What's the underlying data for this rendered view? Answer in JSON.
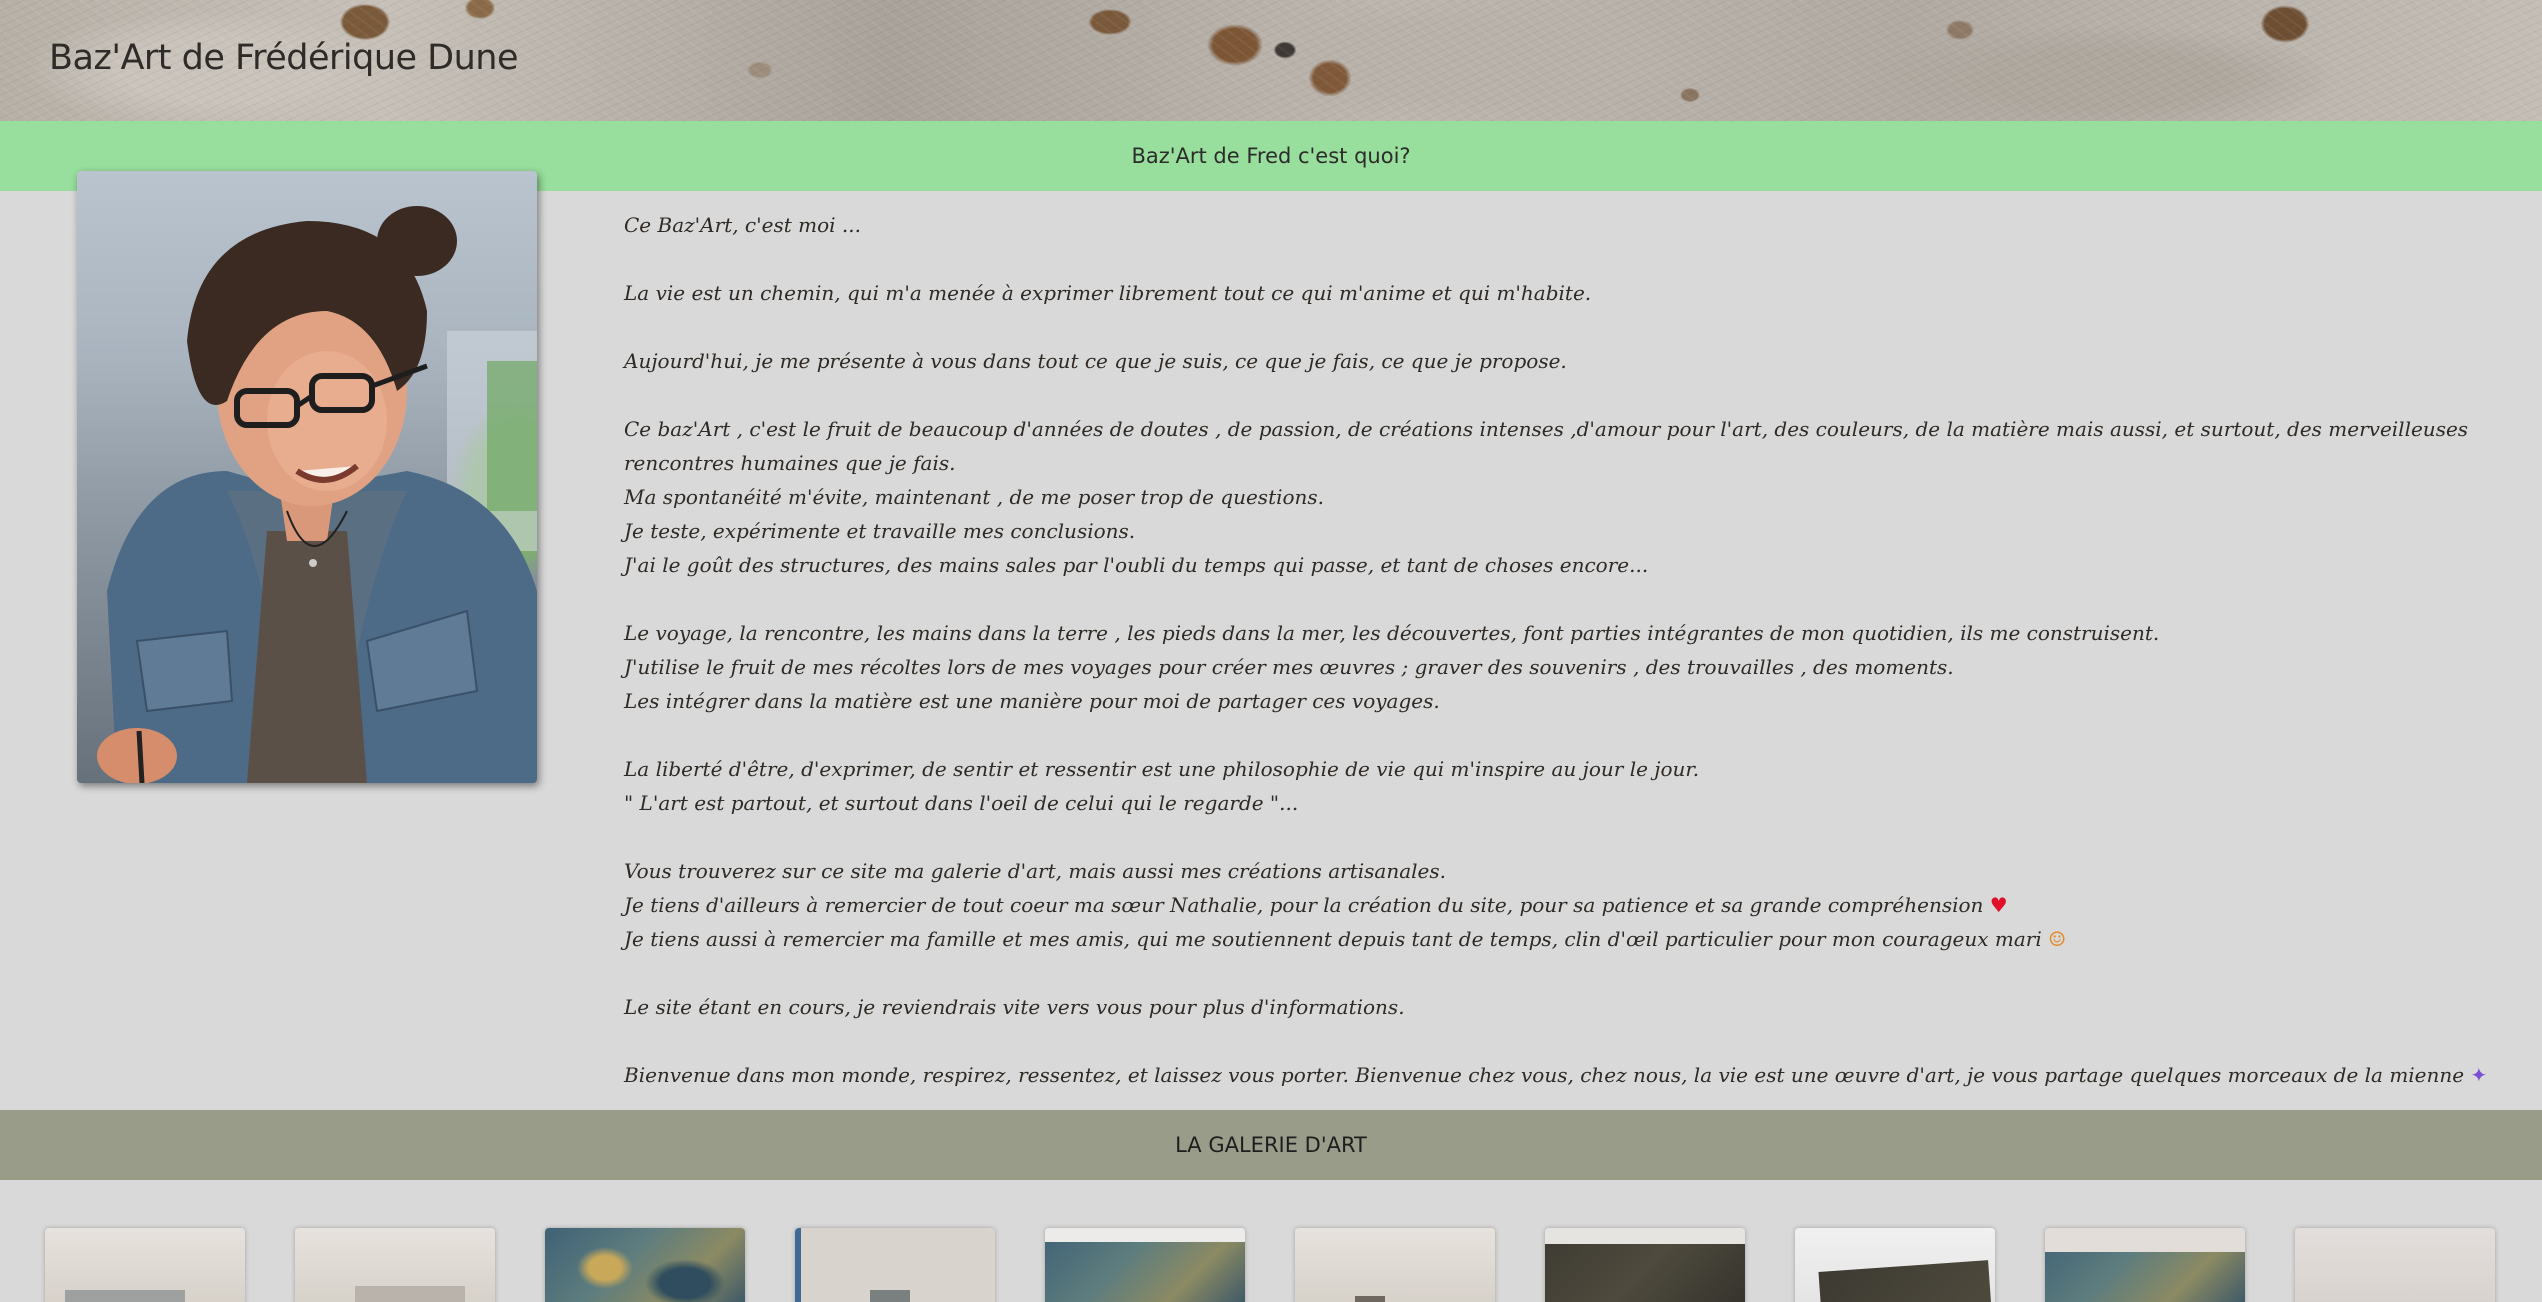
{
  "header": {
    "site_title": "Baz'Art de Frédérique Dune"
  },
  "about_banner": {
    "label": "Baz'Art de Fred c'est quoi?"
  },
  "about": {
    "portrait_alt": "Frédérique Dune",
    "lines": [
      "Ce Baz'Art, c'est moi ...",
      "",
      "La vie est un chemin, qui m'a menée à exprimer librement tout ce qui m'anime et qui m'habite.",
      "",
      "Aujourd'hui, je me présente à vous dans tout ce que je suis, ce que je fais, ce que je propose.",
      "",
      "Ce baz'Art , c'est le fruit de beaucoup d'années de doutes , de passion, de créations intenses ,d'amour pour l'art, des couleurs, de la matière mais aussi, et surtout, des merveilleuses rencontres humaines que je fais.",
      "Ma spontanéité m'évite, maintenant , de me poser trop de questions.",
      "Je teste, expérimente et travaille mes conclusions.",
      "J'ai le goût des structures, des mains sales par l'oubli du temps qui passe, et tant de choses encore...",
      "",
      "Le voyage, la rencontre, les mains dans la terre , les pieds dans la mer, les découvertes, font parties intégrantes de mon quotidien, ils me construisent.",
      "J'utilise le fruit de mes récoltes lors de mes voyages pour créer mes œuvres ; graver des souvenirs , des trouvailles , des moments.",
      "Les intégrer dans la matière est une manière pour moi de partager ces voyages.",
      "",
      "La liberté d'être, d'exprimer, de sentir et ressentir est une philosophie de vie qui m'inspire au jour le jour.",
      "\" L'art est partout, et surtout dans l'oeil de celui qui le regarde \"...",
      "",
      "Vous trouverez sur ce site ma galerie d'art, mais aussi mes créations artisanales.",
      "Je tiens d'ailleurs à remercier de tout coeur ma sœur Nathalie, pour la création du site, pour sa patience et sa grande compréhension",
      "Je tiens aussi à remercier ma famille et mes amis, qui me soutiennent depuis tant de temps, clin d'œil particulier pour mon courageux mari",
      "",
      "Le site étant en cours, je reviendrais vite vers vous pour plus d'informations.",
      "",
      "Bienvenue dans mon monde, respirez, ressentez, et laissez vous porter. Bienvenue chez vous, chez nous, la vie est une œuvre d'art, je vous partage quelques morceaux de la mienne"
    ],
    "heart_emoji": "♥",
    "face_emoji": "☺",
    "sparkle_emoji": "✦"
  },
  "gallery_banner": {
    "label": "LA GALERIE D'ART"
  },
  "gallery": {
    "thumbnail_count": 10
  }
}
